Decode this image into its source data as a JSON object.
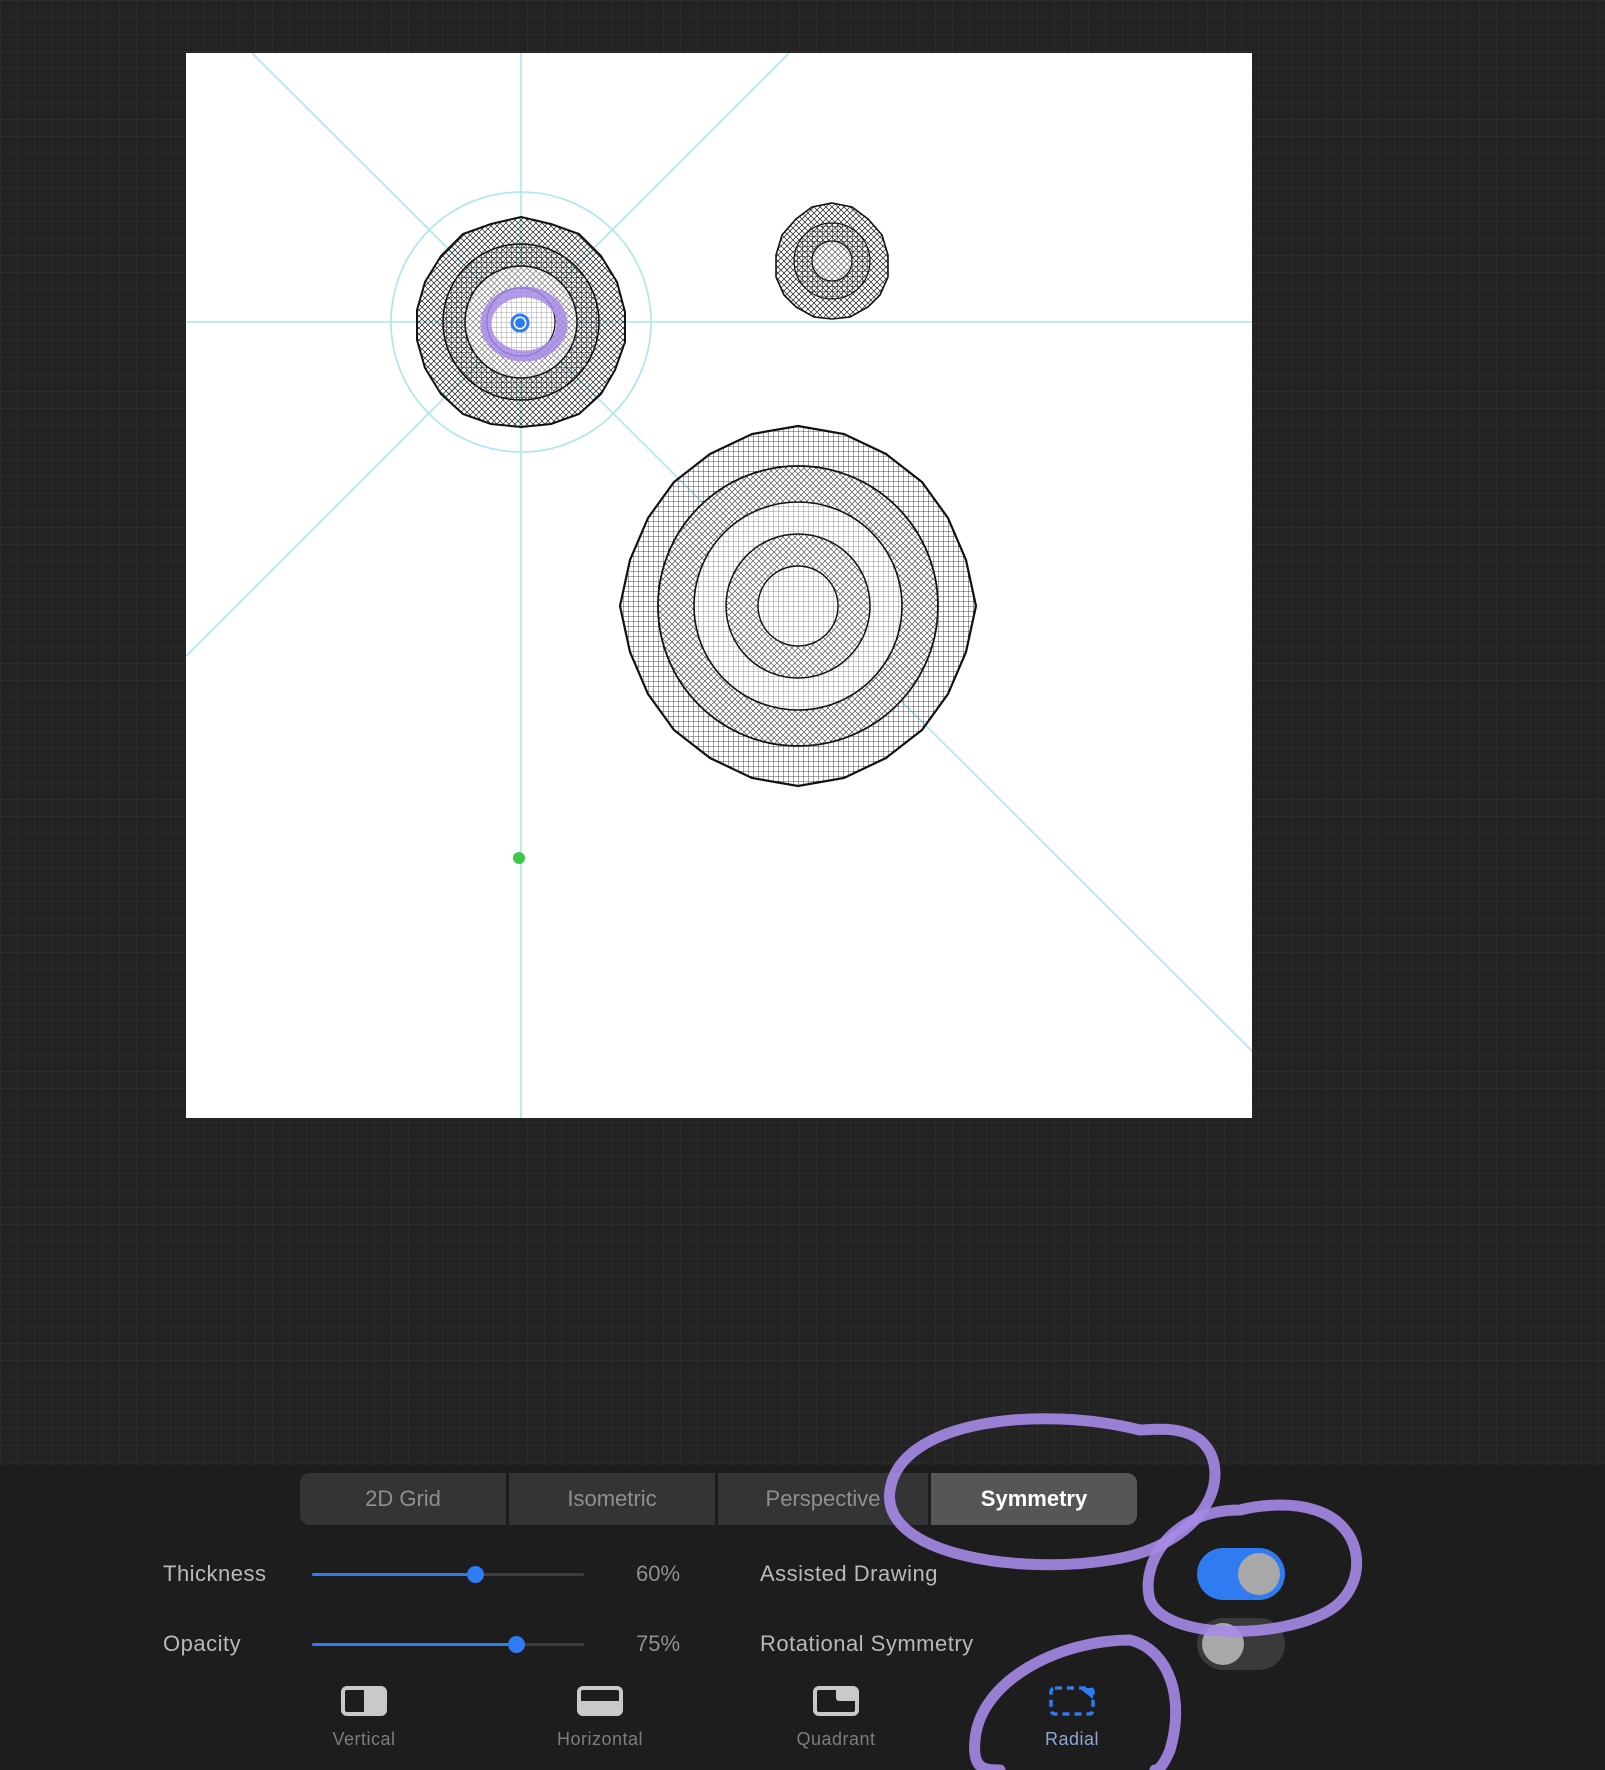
{
  "tabs": [
    {
      "label": "2D Grid",
      "active": false
    },
    {
      "label": "Isometric",
      "active": false
    },
    {
      "label": "Perspective",
      "active": false
    },
    {
      "label": "Symmetry",
      "active": true
    }
  ],
  "sliders": {
    "thickness": {
      "label": "Thickness",
      "value_text": "60%",
      "value": 0.6
    },
    "opacity": {
      "label": "Opacity",
      "value_text": "75%",
      "value": 0.75
    }
  },
  "toggles": {
    "assisted_drawing": {
      "label": "Assisted Drawing",
      "on": true
    },
    "rotational_symmetry": {
      "label": "Rotational Symmetry",
      "on": false
    }
  },
  "symmetry_options": [
    {
      "label": "Vertical",
      "icon": "vertical-symmetry-icon",
      "active": false
    },
    {
      "label": "Horizontal",
      "icon": "horizontal-symmetry-icon",
      "active": false
    },
    {
      "label": "Quadrant",
      "icon": "quadrant-symmetry-icon",
      "active": false
    },
    {
      "label": "Radial",
      "icon": "radial-symmetry-icon",
      "active": true
    }
  ],
  "colors": {
    "accent_blue": "#2f7bf1",
    "guide_cyan": "#a8e6f0",
    "annotation_purple": "#a78be8",
    "handle_green": "#3ec84a"
  }
}
